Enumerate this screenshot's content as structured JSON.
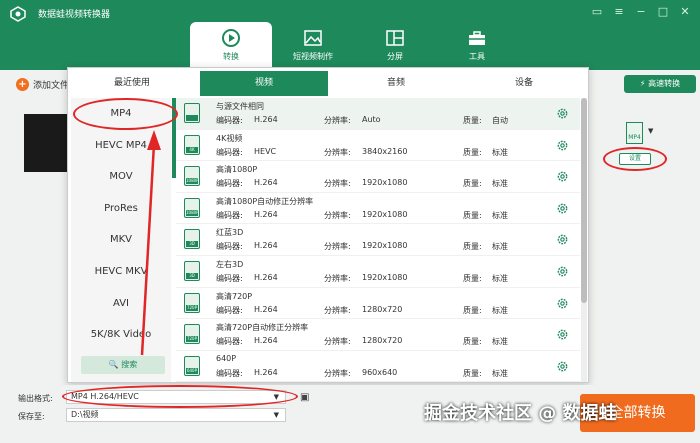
{
  "app": {
    "title": "数据蛙视频转换器",
    "accent": "#1e8a5c",
    "convert_color": "#f06b1e"
  },
  "window_controls": [
    "message-icon",
    "menu-icon",
    "minimize-icon",
    "maximize-icon",
    "close-icon"
  ],
  "nav": {
    "tabs": [
      {
        "label": "转换",
        "icon": "convert-icon",
        "active": true
      },
      {
        "label": "短视频制作",
        "icon": "image-icon",
        "active": false
      },
      {
        "label": "分屏",
        "icon": "split-screen-icon",
        "active": false
      },
      {
        "label": "工具",
        "icon": "toolbox-icon",
        "active": false
      }
    ]
  },
  "toolbar": {
    "add_file": "添加文件",
    "high_speed": "高速转换"
  },
  "file": {
    "format_badge": "MP4",
    "settings_label": "设置"
  },
  "panel": {
    "tabs": [
      "最近使用",
      "视频",
      "音频",
      "设备"
    ],
    "active_tab": "视频",
    "formats": [
      "MP4",
      "HEVC MP4",
      "MOV",
      "ProRes",
      "MKV",
      "HEVC MKV",
      "AVI",
      "5K/8K Video"
    ],
    "selected_format": "MP4",
    "search_label": "搜索",
    "labels": {
      "encoder": "编码器:",
      "resolution": "分辨率:",
      "quality": "质量:"
    },
    "rows": [
      {
        "name": "与源文件相同",
        "badge": "",
        "encoder": "H.264",
        "resolution": "Auto",
        "quality": "自动"
      },
      {
        "name": "4K视频",
        "badge": "4K",
        "encoder": "HEVC",
        "resolution": "3840x2160",
        "quality": "标准"
      },
      {
        "name": "高清1080P",
        "badge": "1080P",
        "encoder": "H.264",
        "resolution": "1920x1080",
        "quality": "标准"
      },
      {
        "name": "高清1080P自动修正分辨率",
        "badge": "1080P",
        "encoder": "H.264",
        "resolution": "1920x1080",
        "quality": "标准"
      },
      {
        "name": "红蓝3D",
        "badge": "3D",
        "encoder": "H.264",
        "resolution": "1920x1080",
        "quality": "标准"
      },
      {
        "name": "左右3D",
        "badge": "3D",
        "encoder": "H.264",
        "resolution": "1920x1080",
        "quality": "标准"
      },
      {
        "name": "高清720P",
        "badge": "720P",
        "encoder": "H.264",
        "resolution": "1280x720",
        "quality": "标准"
      },
      {
        "name": "高清720P自动修正分辨率",
        "badge": "720P",
        "encoder": "H.264",
        "resolution": "1280x720",
        "quality": "标准"
      },
      {
        "name": "640P",
        "badge": "640P",
        "encoder": "H.264",
        "resolution": "960x640",
        "quality": "标准"
      }
    ]
  },
  "bottom": {
    "output_format_label": "输出格式:",
    "output_format_value": "MP4 H.264/HEVC",
    "save_to_label": "保存至:",
    "save_to_value": "D:\\视频",
    "convert_all": "全部转换"
  },
  "watermark": "掘金技术社区 @ 数据蛙"
}
